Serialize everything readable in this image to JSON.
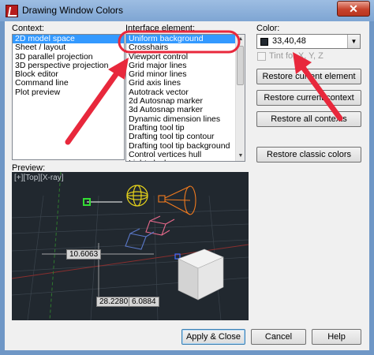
{
  "window": {
    "title": "Drawing Window Colors",
    "close_glyph": "✕"
  },
  "context": {
    "label": "Context:",
    "items": [
      "2D model space",
      "Sheet / layout",
      "3D parallel projection",
      "3D perspective projection",
      "Block editor",
      "Command line",
      "Plot preview"
    ],
    "selected_index": 0
  },
  "interface": {
    "label": "Interface element:",
    "items": [
      "Uniform background",
      "Crosshairs",
      "Viewport control",
      "Grid major lines",
      "Grid minor lines",
      "Grid axis lines",
      "Autotrack vector",
      "2d Autosnap marker",
      "3d Autosnap marker",
      "Dynamic dimension lines",
      "Drafting tool tip",
      "Drafting tool tip contour",
      "Drafting tool tip background",
      "Control vertices hull",
      "Light glyphs"
    ],
    "selected_index": 0
  },
  "color": {
    "label": "Color:",
    "value": "33,40,48",
    "swatch_hex": "#21282f",
    "tint_label": "Tint for X, Y, Z",
    "tint_checked": false
  },
  "buttons": {
    "restore_current_element": "Restore current element",
    "restore_current_context": "Restore current context",
    "restore_all_contexts": "Restore all contexts",
    "restore_classic_colors": "Restore classic colors",
    "apply_close": "Apply & Close",
    "cancel": "Cancel",
    "help": "Help"
  },
  "preview": {
    "label": "Preview:",
    "view_label": "[+][Top][X-ray]",
    "dim1": "10.6063",
    "dim2": "28.2280",
    "dim3": "6.0884"
  },
  "annotation_color": "#e8283c"
}
